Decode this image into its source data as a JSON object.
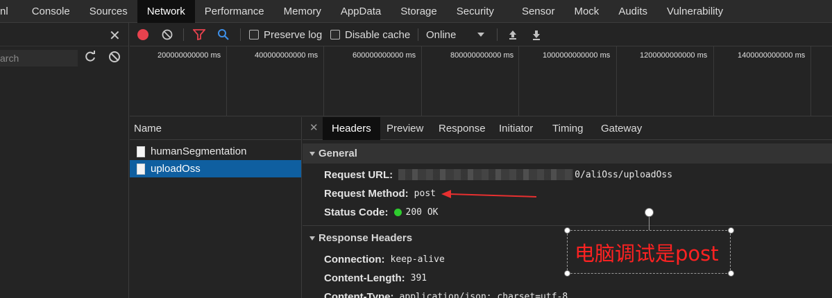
{
  "top_tabs": [
    "nl",
    "Console",
    "Sources",
    "Network",
    "Performance",
    "Memory",
    "AppData",
    "Storage",
    "Security",
    "Sensor",
    "Mock",
    "Audits",
    "Vulnerability"
  ],
  "left_panel": {
    "search_placeholder": "arch"
  },
  "toolbar": {
    "preserve_log": "Preserve log",
    "disable_cache": "Disable cache",
    "throttle": "Online"
  },
  "timeline_labels": [
    "200000000000 ms",
    "400000000000 ms",
    "600000000000 ms",
    "800000000000 ms",
    "1000000000000 ms",
    "1200000000000 ms",
    "1400000000000 ms"
  ],
  "requests": {
    "header": "Name",
    "items": [
      "humanSegmentation",
      "uploadOss"
    ],
    "selected_index": 1
  },
  "detail": {
    "tabs": [
      "Headers",
      "Preview",
      "Response",
      "Initiator",
      "Timing",
      "Gateway"
    ],
    "active_tab": "Headers",
    "general": {
      "title": "General",
      "request_url_key": "Request URL:",
      "request_url_suffix": "0/aliOss/uploadOss",
      "request_method_key": "Request Method:",
      "request_method_val": "post",
      "status_code_key": "Status Code:",
      "status_code_val": "200 OK"
    },
    "response_headers": {
      "title": "Response Headers",
      "connection_key": "Connection:",
      "connection_val": "keep-alive",
      "content_length_key": "Content-Length:",
      "content_length_val": "391",
      "content_type_key": "Content-Type:",
      "content_type_val": "application/json; charset=utf-8"
    }
  },
  "annotation": {
    "text": "电脑调试是post",
    "color": "#ff2222"
  },
  "colors": {
    "record": "#e8424e",
    "filter": "#e8424e",
    "search": "#3d8fe8",
    "selected_row": "#0f5fa0",
    "status_ok": "#2ecc2e"
  }
}
